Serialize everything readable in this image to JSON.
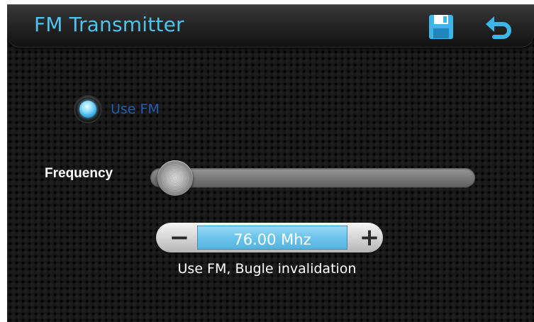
{
  "header": {
    "title": "FM Transmitter",
    "save_icon": "floppy-disk-icon",
    "back_icon": "return-arrow-icon"
  },
  "fm_toggle": {
    "label": "Use FM",
    "selected": true
  },
  "frequency": {
    "label": "Frequency",
    "slider_value_fraction": 0.0
  },
  "stepper": {
    "minus_label": "−",
    "plus_label": "+",
    "value": "76.00 Mhz"
  },
  "status": {
    "message": "Use FM, Bugle invalidation"
  },
  "colors": {
    "title": "#4fc3ee",
    "accent": "#2fa7e0",
    "radio_label": "#1e5fb0",
    "display_fill": "#6cc4ea"
  }
}
